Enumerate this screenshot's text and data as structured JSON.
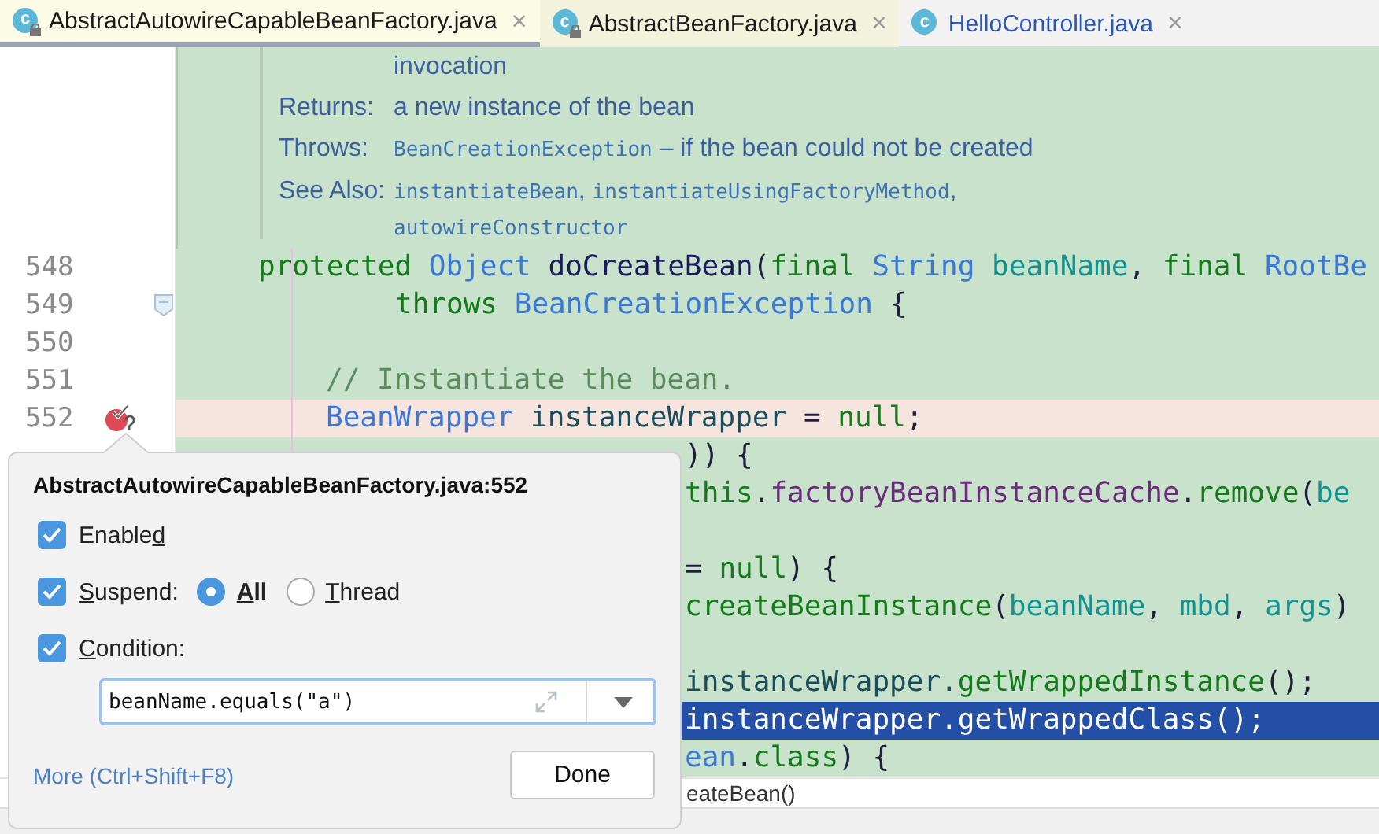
{
  "tabs": [
    {
      "label": "AbstractAutowireCapableBeanFactory.java",
      "icon_text": "c",
      "locked": true,
      "selected": true,
      "color": "#1a1a1a",
      "close": "×"
    },
    {
      "label": "AbstractBeanFactory.java",
      "icon_text": "c",
      "locked": true,
      "selected": false,
      "color": "#1a1a1a",
      "close": "×"
    },
    {
      "label": "HelloController.java",
      "icon_text": "c",
      "locked": false,
      "selected": false,
      "color": "#2a56b8",
      "close": "×"
    }
  ],
  "doc": {
    "continuation": "invocation",
    "entries": [
      {
        "label": "Returns:",
        "lines": [
          [
            {
              "kind": "text",
              "t": "a new instance of the bean"
            }
          ]
        ]
      },
      {
        "label": "Throws:",
        "lines": [
          [
            {
              "kind": "code",
              "t": "BeanCreationException"
            },
            {
              "kind": "text",
              "t": " – if the bean could not be created"
            }
          ]
        ]
      },
      {
        "label": "See Also:",
        "lines": [
          [
            {
              "kind": "code",
              "t": "instantiateBean"
            },
            {
              "kind": "text",
              "t": ", "
            },
            {
              "kind": "code",
              "t": "instantiateUsingFactoryMethod"
            },
            {
              "kind": "text",
              "t": ","
            }
          ],
          [
            {
              "kind": "code",
              "t": "autowireConstructor"
            }
          ]
        ]
      }
    ]
  },
  "lines": [
    {
      "number": "548",
      "kind": "signature",
      "fold": false,
      "breakpoint": false,
      "selected": false,
      "tokens": [
        {
          "kind": "keyword",
          "t": "protected "
        },
        {
          "kind": "type",
          "t": "Object "
        },
        {
          "kind": "decl",
          "t": "doCreateBean"
        },
        {
          "kind": "plain",
          "t": "("
        },
        {
          "kind": "keyword",
          "t": "final "
        },
        {
          "kind": "type",
          "t": "String "
        },
        {
          "kind": "param",
          "t": "beanName"
        },
        {
          "kind": "plain",
          "t": ", "
        },
        {
          "kind": "keyword",
          "t": "final "
        },
        {
          "kind": "type",
          "t": "RootBe"
        }
      ]
    },
    {
      "number": "549",
      "kind": "wrapped",
      "fold": true,
      "breakpoint": false,
      "selected": false,
      "tokens": [
        {
          "kind": "keyword",
          "t": "throws "
        },
        {
          "kind": "type",
          "t": "BeanCreationException "
        },
        {
          "kind": "plain",
          "t": "{"
        }
      ]
    },
    {
      "number": "550",
      "kind": "body",
      "fold": false,
      "breakpoint": false,
      "selected": false
    },
    {
      "number": "551",
      "kind": "body",
      "fold": false,
      "breakpoint": false,
      "selected": false,
      "tokens": [
        {
          "kind": "comment",
          "t": "// Instantiate the bean."
        }
      ]
    },
    {
      "number": "552",
      "kind": "body",
      "fold": false,
      "breakpoint": true,
      "selected": false,
      "tokens": [
        {
          "kind": "type",
          "t": "BeanWrapper "
        },
        {
          "kind": "local",
          "t": "instanceWrapper "
        },
        {
          "kind": "plain",
          "t": "= "
        },
        {
          "kind": "keyword",
          "t": "null"
        },
        {
          "kind": "plain",
          "t": ";"
        }
      ]
    },
    {
      "kind": "tail",
      "breakpoint": false,
      "selected": false,
      "tokens": [
        {
          "kind": "plain",
          "t": ")) {"
        }
      ]
    },
    {
      "kind": "tail",
      "breakpoint": false,
      "selected": false,
      "tokens": [
        {
          "kind": "keyword",
          "t": "this"
        },
        {
          "kind": "plain",
          "t": "."
        },
        {
          "kind": "field",
          "t": "factoryBeanInstanceCache"
        },
        {
          "kind": "plain",
          "t": "."
        },
        {
          "kind": "method",
          "t": "remove"
        },
        {
          "kind": "plain",
          "t": "("
        },
        {
          "kind": "param",
          "t": "be"
        }
      ]
    },
    {
      "kind": "tail",
      "breakpoint": false,
      "selected": false
    },
    {
      "kind": "tail",
      "breakpoint": false,
      "selected": false,
      "tokens": [
        {
          "kind": "plain",
          "t": "= "
        },
        {
          "kind": "keyword",
          "t": "null"
        },
        {
          "kind": "plain",
          "t": ") {"
        }
      ]
    },
    {
      "kind": "tail",
      "breakpoint": false,
      "selected": false,
      "tokens": [
        {
          "kind": "method",
          "t": "createBeanInstance"
        },
        {
          "kind": "plain",
          "t": "("
        },
        {
          "kind": "param",
          "t": "beanName"
        },
        {
          "kind": "plain",
          "t": ", "
        },
        {
          "kind": "param",
          "t": "mbd"
        },
        {
          "kind": "plain",
          "t": ", "
        },
        {
          "kind": "param",
          "t": "args"
        },
        {
          "kind": "plain",
          "t": ")"
        }
      ]
    },
    {
      "kind": "tail",
      "breakpoint": false,
      "selected": false
    },
    {
      "kind": "tail",
      "breakpoint": false,
      "selected": false,
      "tokens": [
        {
          "kind": "local",
          "t": "instanceWrapper."
        },
        {
          "kind": "method",
          "t": "getWrappedInstance"
        },
        {
          "kind": "plain",
          "t": "();"
        }
      ]
    },
    {
      "kind": "tail",
      "breakpoint": false,
      "selected": true,
      "tokens": [
        {
          "kind": "local",
          "t": "instanceWrapper."
        },
        {
          "kind": "method",
          "t": "getWrappedClass"
        },
        {
          "kind": "plain",
          "t": "();"
        }
      ]
    },
    {
      "kind": "tail",
      "breakpoint": false,
      "selected": false,
      "tokens": [
        {
          "kind": "type",
          "t": "ean"
        },
        {
          "kind": "plain",
          "t": "."
        },
        {
          "kind": "keyword",
          "t": "class"
        },
        {
          "kind": "plain",
          "t": ") {"
        }
      ]
    }
  ],
  "breadcrumb": "eateBean()",
  "popup": {
    "title": "AbstractAutowireCapableBeanFactory.java:552",
    "enabled": {
      "checked": true,
      "label": {
        "before": "Enable",
        "key": "d"
      }
    },
    "suspend": {
      "checked": true,
      "label": {
        "key": "S",
        "after": "uspend:"
      },
      "options": [
        {
          "label": {
            "key": "A",
            "after": "ll"
          },
          "selected": true
        },
        {
          "label": {
            "key": "T",
            "after": "hread"
          },
          "selected": false
        }
      ]
    },
    "condition": {
      "checked": true,
      "label": {
        "key": "C",
        "after": "ondition:"
      },
      "value": "beanName.equals(\"a\")"
    },
    "more_link": "More (Ctrl+Shift+F8)",
    "done": "Done"
  }
}
